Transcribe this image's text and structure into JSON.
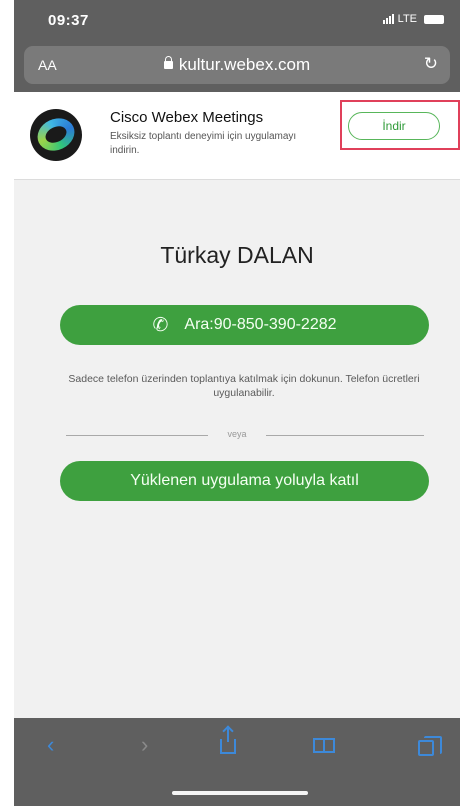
{
  "status_bar": {
    "time": "09:37",
    "network": "LTE"
  },
  "address_bar": {
    "text_size_label": "AA",
    "url": "kultur.webex.com"
  },
  "app_banner": {
    "app_name": "Cisco Webex Meetings",
    "description": "Eksiksiz toplantı deneyimi için uygulamayı indirin.",
    "download_label": "İndir"
  },
  "meeting": {
    "host_name": "Türkay DALAN",
    "call_label": "Ara:90-850-390-2282",
    "note": "Sadece telefon üzerinden toplantıya katılmak için dokunun. Telefon ücretleri uygulanabilir.",
    "or_label": "veya",
    "app_join_label": "Yüklenen uygulama yoluyla katıl"
  },
  "colors": {
    "accent_green": "#3ea03f",
    "highlight_red": "#e0405a",
    "ios_blue": "#3d89d9"
  },
  "icons": [
    "lock-icon",
    "reload-icon",
    "webex-logo",
    "phone-icon",
    "back-icon",
    "forward-icon",
    "share-icon",
    "bookmarks-icon",
    "tabs-icon"
  ]
}
